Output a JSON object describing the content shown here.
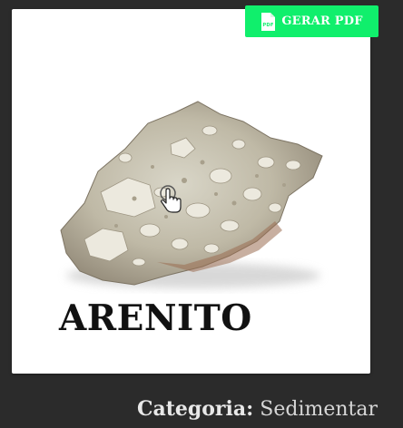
{
  "pdf_button": {
    "label": "GERAR PDF",
    "icon_text": "PDF",
    "icon": "pdf-file-icon",
    "color": "#10ef6c"
  },
  "card": {
    "image": "rock-specimen",
    "cursor_icon": "hand-pointer-icon",
    "title": "ARENITO"
  },
  "category": {
    "label": "Categoria:",
    "value": "Sedimentar"
  },
  "colors": {
    "page_background": "#2b2b2b",
    "card_background": "#ffffff",
    "title_text": "#111111"
  }
}
